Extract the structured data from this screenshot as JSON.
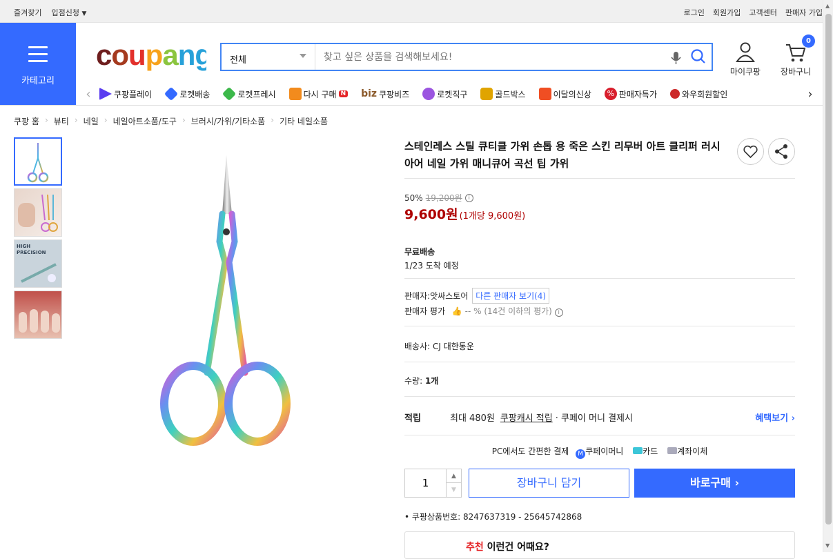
{
  "topbar": {
    "left": [
      "즐겨찾기",
      "입점신청"
    ],
    "right": [
      "로그인",
      "회원가입",
      "고객센터",
      "판매자 가입"
    ]
  },
  "header": {
    "category_label": "카테고리",
    "logo": "coupang",
    "search": {
      "category": "전체",
      "placeholder": "찾고 싶은 상품을 검색해보세요!"
    },
    "mycoupang": "마이쿠팡",
    "cart": "장바구니",
    "cart_count": "0"
  },
  "nav": {
    "items": [
      {
        "label": "쿠팡플레이",
        "color": "#5a3cf0"
      },
      {
        "label": "로켓배송",
        "color": "#346aff"
      },
      {
        "label": "로켓프레시",
        "color": "#3cb84a"
      },
      {
        "label": "다시 구매",
        "color": "#f28b1d"
      },
      {
        "label": "쿠팡비즈",
        "color": "#8b5a2b"
      },
      {
        "label": "로켓직구",
        "color": "#9b55e0"
      },
      {
        "label": "골드박스",
        "color": "#e0a400"
      },
      {
        "label": "이달의신상",
        "color": "#f04e23"
      },
      {
        "label": "판매자특가",
        "color": "#d81e2c"
      },
      {
        "label": "와우회원할인",
        "color": "#cc2a2a"
      }
    ]
  },
  "breadcrumb": [
    "쿠팡 홈",
    "뷰티",
    "네일",
    "네일아트소품/도구",
    "브러시/가위/기타소품",
    "기타 네일소품"
  ],
  "product": {
    "title": "스테인레스 스틸 큐티클 가위 손톱 용 죽은 스킨 리무버 아트 클리퍼 러시아어 네일 가위 매니큐어 곡선 팁 가위",
    "discount_rate": "50%",
    "original_price": "19,200원",
    "price": "9,600원",
    "unit_price": "(1개당 9,600원)",
    "shipping_title": "무료배송",
    "arrival": "1/23 도착 예정",
    "seller_label": "판매자:",
    "seller": "앗싸스토어",
    "other_sellers": "다른 판매자 보기(4)",
    "seller_rating_label": "판매자 평가",
    "seller_rating": "-- %",
    "seller_rating_note": "(14건 이하의 평가)",
    "carrier": "배송사:  CJ 대한통운",
    "quantity_label": "수량:",
    "quantity_value": "1개",
    "reward_label": "적립",
    "reward_text_1": "최대 480원",
    "reward_text_2": "쿠팡캐시 적립",
    "reward_text_3": "· 쿠페이 머니 결제시",
    "reward_link": "혜택보기",
    "pc_pay": "PC에서도 간편한 결제",
    "pay_methods": [
      "쿠페이머니",
      "카드",
      "계좌이체"
    ],
    "qty_input": "1",
    "cart_button": "장바구니 담기",
    "buy_button": "바로구매",
    "product_number": "쿠팡상품번호: 8247637319 - 25645742868",
    "reco_red": "추천",
    "reco_text": " 이런건 어때요?"
  },
  "thumbnails": [
    "scissors",
    "hand-scissors",
    "HIGH PRECISION",
    "nails"
  ]
}
